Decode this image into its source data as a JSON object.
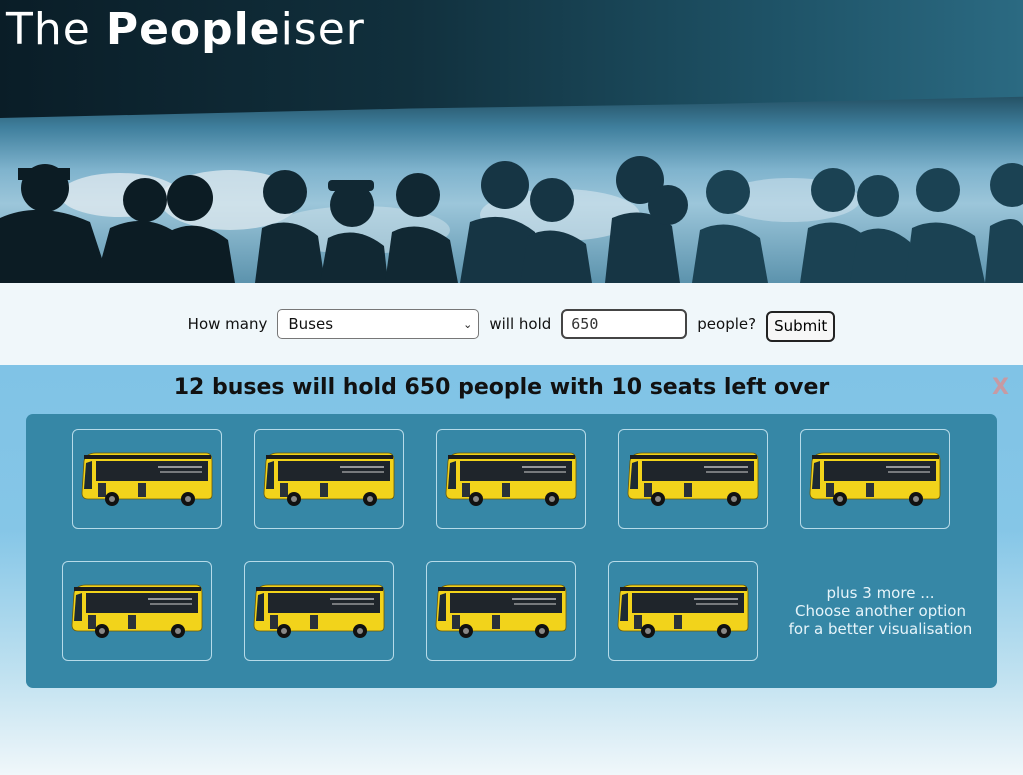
{
  "header": {
    "title_part1": "The ",
    "title_bold": "Peopl",
    "title_bold2": "e",
    "title_part2": "iser"
  },
  "form": {
    "how_many_label": "How many",
    "vehicle_selected": "Buses",
    "will_hold_label": "will hold",
    "people_value": "650",
    "people_label": "people?",
    "submit_label": "Submit"
  },
  "result": {
    "heading": "12 buses will hold 650 people with 10 seats left over",
    "close_label": "X",
    "tiles_shown": 9,
    "more_line1": "plus 3 more ...",
    "more_line2": "Choose another option",
    "more_line3": "for a better visualisation"
  },
  "colors": {
    "panel": "#3687a6",
    "bus_body": "#f2d31b",
    "result_bg": "#80c3e6"
  }
}
